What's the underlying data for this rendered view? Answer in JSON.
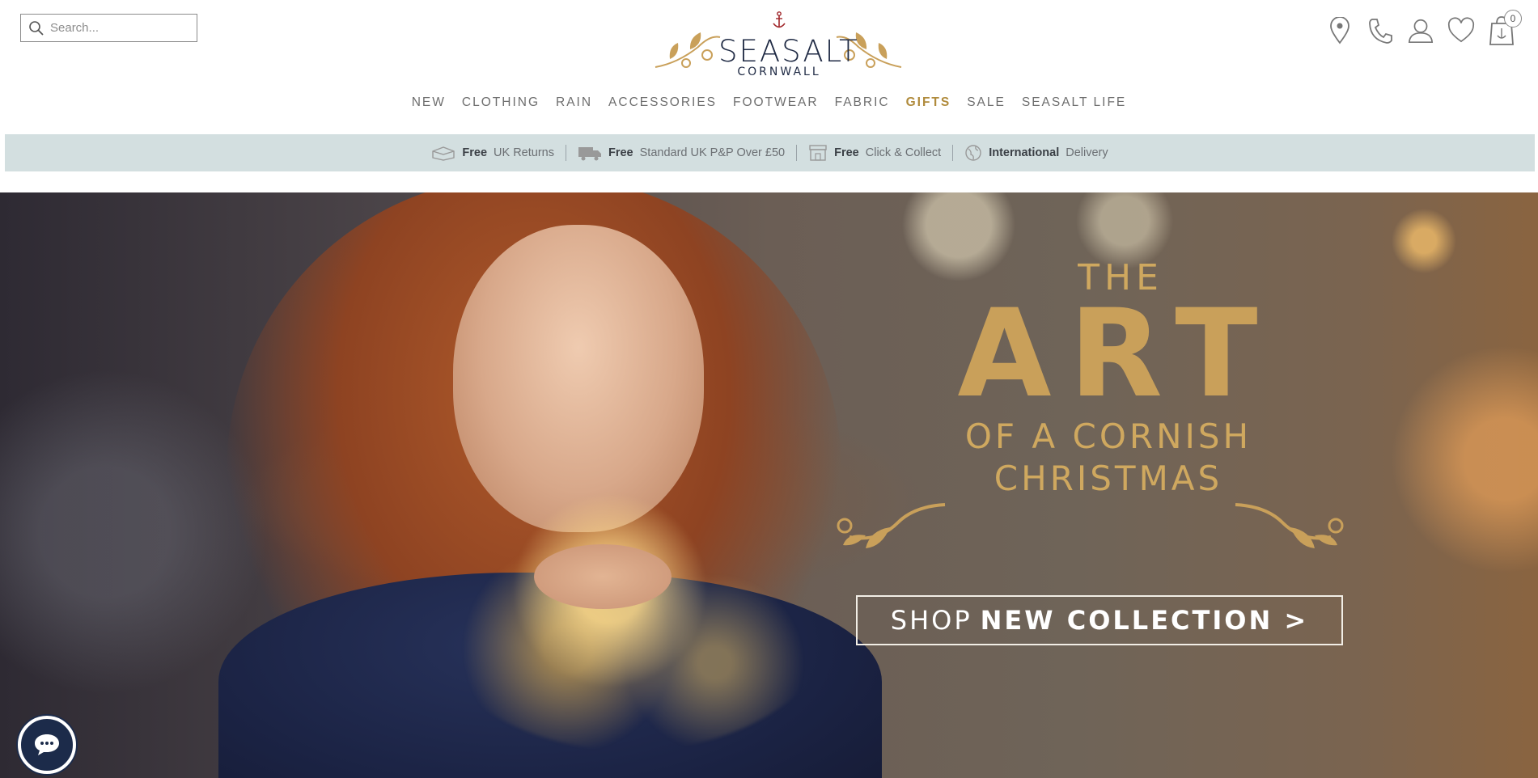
{
  "search": {
    "placeholder": "Search..."
  },
  "logo": {
    "brand": "SEASALT",
    "sub": "CORNWALL"
  },
  "header_icons": [
    "location-icon",
    "phone-icon",
    "account-icon",
    "wishlist-icon",
    "bag-icon"
  ],
  "bag": {
    "count": "0"
  },
  "nav": {
    "items": [
      {
        "label": "NEW"
      },
      {
        "label": "CLOTHING"
      },
      {
        "label": "RAIN"
      },
      {
        "label": "ACCESSORIES"
      },
      {
        "label": "FOOTWEAR"
      },
      {
        "label": "FABRIC"
      },
      {
        "label": "GIFTS"
      },
      {
        "label": "SALE"
      },
      {
        "label": "SEASALT LIFE"
      }
    ]
  },
  "benefits": [
    {
      "bold": "Free",
      "text": "UK Returns",
      "icon": "returns-box-icon"
    },
    {
      "bold": "Free",
      "text": "Standard UK P&P Over £50",
      "icon": "delivery-truck-icon"
    },
    {
      "bold": "Free",
      "text": "Click & Collect",
      "icon": "store-icon"
    },
    {
      "bold": "International",
      "text": "Delivery",
      "icon": "globe-icon"
    }
  ],
  "hero": {
    "the": "THE",
    "art": "ART",
    "line1": "OF A CORNISH",
    "line2": "CHRISTMAS",
    "cta_prefix": "SHOP",
    "cta_bold": "NEW COLLECTION >"
  },
  "colors": {
    "gold": "#c9a05a",
    "navy": "#1f2a44",
    "benefit_bg": "#d3dfe0",
    "gifts": "#b08b3c"
  }
}
